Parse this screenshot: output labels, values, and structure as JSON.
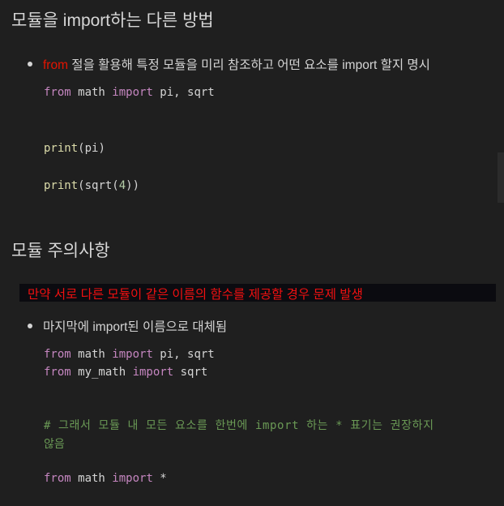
{
  "heading1": "모듈을 import하는 다른 방법",
  "bullet1": {
    "keyword": "from",
    "text": " 절을 활용해 특정 모듈을 미리 참조하고 어떤 요소를 import 할지 명시"
  },
  "code1": [
    [
      [
        "kw",
        "from"
      ],
      [
        "plain",
        " math "
      ],
      [
        "kw",
        "import"
      ],
      [
        "plain",
        " pi, sqrt"
      ]
    ],
    [
      [
        "fn",
        "print"
      ],
      [
        "plain",
        "(pi)"
      ]
    ],
    [
      [
        "fn",
        "print"
      ],
      [
        "plain",
        "(sqrt("
      ],
      [
        "num",
        "4"
      ],
      [
        "plain",
        "))"
      ]
    ]
  ],
  "heading2": "모듈 주의사항",
  "warning": "만약 서로 다른 모듈이 같은 이름의 함수를 제공할 경우 문제 발생",
  "bullet2": "마지막에 import된 이름으로 대체됨",
  "code2": [
    [
      [
        "kw",
        "from"
      ],
      [
        "plain",
        " math "
      ],
      [
        "kw",
        "import"
      ],
      [
        "plain",
        " pi, sqrt"
      ]
    ],
    [
      [
        "kw",
        "from"
      ],
      [
        "plain",
        " my_math "
      ],
      [
        "kw",
        "import"
      ],
      [
        "plain",
        " sqrt"
      ]
    ],
    [
      [
        "cm",
        "# 그래서 모듈 내 모든 요소를 한번에 import 하는 * 표기는 권장하지"
      ]
    ],
    [
      [
        "cm",
        "않음"
      ]
    ],
    [
      [
        "kw",
        "from"
      ],
      [
        "plain",
        " math "
      ],
      [
        "kw",
        "import"
      ],
      [
        "plain",
        " *"
      ]
    ]
  ]
}
